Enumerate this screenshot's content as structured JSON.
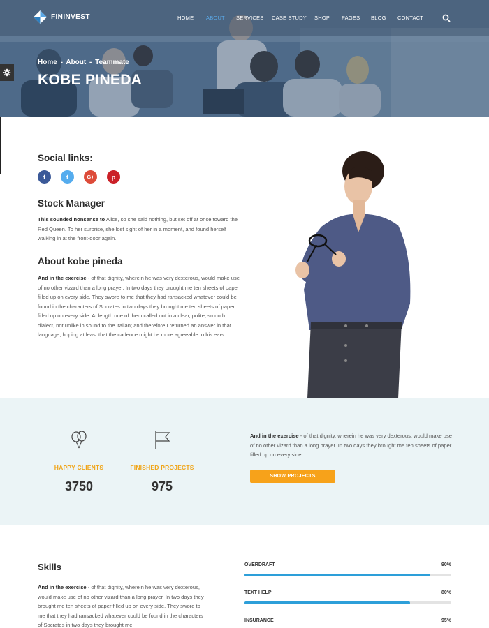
{
  "brand": {
    "logo_part1": "FIN",
    "logo_part2": "INVEST",
    "accent": "#5aa8e6"
  },
  "nav": {
    "items": [
      "HOME",
      "ABOUT",
      "SERVICES",
      "CASE STUDY",
      "SHOP",
      "PAGES",
      "BLOG",
      "CONTACT"
    ],
    "active": "ABOUT"
  },
  "hero": {
    "breadcrumb": [
      "Home",
      "-",
      "About",
      "-",
      "Teammate"
    ],
    "title": "KOBE PINEDA"
  },
  "profile": {
    "social_heading": "Social links:",
    "social": [
      {
        "icon": "facebook-icon",
        "glyph": "f",
        "color": "#3b5998"
      },
      {
        "icon": "twitter-icon",
        "glyph": "t",
        "color": "#55acee"
      },
      {
        "icon": "google-plus-icon",
        "glyph": "G+",
        "color": "#dd4b39"
      },
      {
        "icon": "pinterest-icon",
        "glyph": "p",
        "color": "#cb2027"
      }
    ],
    "role_heading": "Stock Manager",
    "role_lead": "This sounded nonsense to",
    "role_text": " Alice, so she said nothing, but set off at once toward the Red Queen. To her surprise, she lost sight of her in a moment, and found herself walking in at the front-door again.",
    "about_heading": "About kobe pineda",
    "about_lead": "And in the exercise",
    "about_text": " - of that dignity, wherein he was very dexterous, would make use of no other vizard than a long prayer. In two days they brought me ten sheets of paper filled up on every side. They swore to me that they had ransacked whatever could be found in the characters of Socrates in two days they brought me ten sheets of paper filled up on every side. At length one of them called out in a clear, polite, smooth dialect, not unlike in sound to the Italian; and therefore I returned an answer in that language, hoping at least that the cadence might be more agreeable to his ears."
  },
  "stats": {
    "items": [
      {
        "label": "HAPPY CLIENTS",
        "value": "3750",
        "icon": "balloons-icon"
      },
      {
        "label": "FINISHED PROJECTS",
        "value": "975",
        "icon": "flag-icon"
      }
    ],
    "text_lead": "And in the exercise",
    "text": " - of that dignity, wherein he was very dexterous, would make use of no other vizard than a long prayer. In two days they brought me ten sheets of paper filled up on every side.",
    "button": "SHOW PROJECTS",
    "label_color": "#f0a519",
    "button_color": "#f7a21a"
  },
  "skills": {
    "heading": "Skills",
    "text_lead": "And in the exercise",
    "text": " - of that dignity, wherein he was very dexterous, would make use of no other vizard than a long prayer. In two days they brought me ten sheets of paper filled up on every side. They swore to me that they had ransacked whatever could be found in the characters of Socrates in two days they brought me",
    "bars": [
      {
        "label": "OVERDRAFT",
        "percent_label": "90%",
        "value": 0.9
      },
      {
        "label": "TEXT HELP",
        "percent_label": "80%",
        "value": 0.8
      },
      {
        "label": "INSURANCE",
        "percent_label": "95%",
        "value": 0.95
      }
    ],
    "bar_color": "#2d9fd9"
  }
}
